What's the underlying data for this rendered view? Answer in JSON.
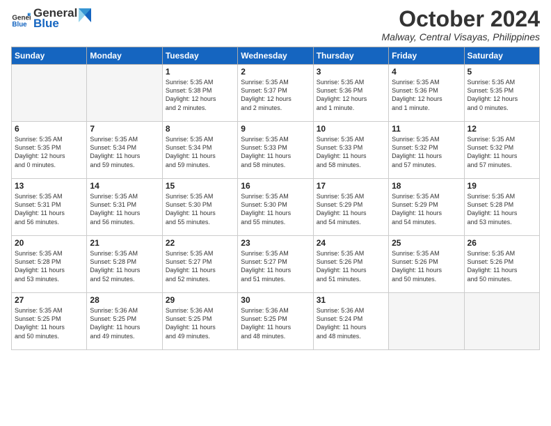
{
  "header": {
    "logo_general": "General",
    "logo_blue": "Blue",
    "month": "October 2024",
    "location": "Malway, Central Visayas, Philippines"
  },
  "days_of_week": [
    "Sunday",
    "Monday",
    "Tuesday",
    "Wednesday",
    "Thursday",
    "Friday",
    "Saturday"
  ],
  "weeks": [
    [
      {
        "day": "",
        "info": ""
      },
      {
        "day": "",
        "info": ""
      },
      {
        "day": "1",
        "info": "Sunrise: 5:35 AM\nSunset: 5:38 PM\nDaylight: 12 hours\nand 2 minutes."
      },
      {
        "day": "2",
        "info": "Sunrise: 5:35 AM\nSunset: 5:37 PM\nDaylight: 12 hours\nand 2 minutes."
      },
      {
        "day": "3",
        "info": "Sunrise: 5:35 AM\nSunset: 5:36 PM\nDaylight: 12 hours\nand 1 minute."
      },
      {
        "day": "4",
        "info": "Sunrise: 5:35 AM\nSunset: 5:36 PM\nDaylight: 12 hours\nand 1 minute."
      },
      {
        "day": "5",
        "info": "Sunrise: 5:35 AM\nSunset: 5:35 PM\nDaylight: 12 hours\nand 0 minutes."
      }
    ],
    [
      {
        "day": "6",
        "info": "Sunrise: 5:35 AM\nSunset: 5:35 PM\nDaylight: 12 hours\nand 0 minutes."
      },
      {
        "day": "7",
        "info": "Sunrise: 5:35 AM\nSunset: 5:34 PM\nDaylight: 11 hours\nand 59 minutes."
      },
      {
        "day": "8",
        "info": "Sunrise: 5:35 AM\nSunset: 5:34 PM\nDaylight: 11 hours\nand 59 minutes."
      },
      {
        "day": "9",
        "info": "Sunrise: 5:35 AM\nSunset: 5:33 PM\nDaylight: 11 hours\nand 58 minutes."
      },
      {
        "day": "10",
        "info": "Sunrise: 5:35 AM\nSunset: 5:33 PM\nDaylight: 11 hours\nand 58 minutes."
      },
      {
        "day": "11",
        "info": "Sunrise: 5:35 AM\nSunset: 5:32 PM\nDaylight: 11 hours\nand 57 minutes."
      },
      {
        "day": "12",
        "info": "Sunrise: 5:35 AM\nSunset: 5:32 PM\nDaylight: 11 hours\nand 57 minutes."
      }
    ],
    [
      {
        "day": "13",
        "info": "Sunrise: 5:35 AM\nSunset: 5:31 PM\nDaylight: 11 hours\nand 56 minutes."
      },
      {
        "day": "14",
        "info": "Sunrise: 5:35 AM\nSunset: 5:31 PM\nDaylight: 11 hours\nand 56 minutes."
      },
      {
        "day": "15",
        "info": "Sunrise: 5:35 AM\nSunset: 5:30 PM\nDaylight: 11 hours\nand 55 minutes."
      },
      {
        "day": "16",
        "info": "Sunrise: 5:35 AM\nSunset: 5:30 PM\nDaylight: 11 hours\nand 55 minutes."
      },
      {
        "day": "17",
        "info": "Sunrise: 5:35 AM\nSunset: 5:29 PM\nDaylight: 11 hours\nand 54 minutes."
      },
      {
        "day": "18",
        "info": "Sunrise: 5:35 AM\nSunset: 5:29 PM\nDaylight: 11 hours\nand 54 minutes."
      },
      {
        "day": "19",
        "info": "Sunrise: 5:35 AM\nSunset: 5:28 PM\nDaylight: 11 hours\nand 53 minutes."
      }
    ],
    [
      {
        "day": "20",
        "info": "Sunrise: 5:35 AM\nSunset: 5:28 PM\nDaylight: 11 hours\nand 53 minutes."
      },
      {
        "day": "21",
        "info": "Sunrise: 5:35 AM\nSunset: 5:28 PM\nDaylight: 11 hours\nand 52 minutes."
      },
      {
        "day": "22",
        "info": "Sunrise: 5:35 AM\nSunset: 5:27 PM\nDaylight: 11 hours\nand 52 minutes."
      },
      {
        "day": "23",
        "info": "Sunrise: 5:35 AM\nSunset: 5:27 PM\nDaylight: 11 hours\nand 51 minutes."
      },
      {
        "day": "24",
        "info": "Sunrise: 5:35 AM\nSunset: 5:26 PM\nDaylight: 11 hours\nand 51 minutes."
      },
      {
        "day": "25",
        "info": "Sunrise: 5:35 AM\nSunset: 5:26 PM\nDaylight: 11 hours\nand 50 minutes."
      },
      {
        "day": "26",
        "info": "Sunrise: 5:35 AM\nSunset: 5:26 PM\nDaylight: 11 hours\nand 50 minutes."
      }
    ],
    [
      {
        "day": "27",
        "info": "Sunrise: 5:35 AM\nSunset: 5:25 PM\nDaylight: 11 hours\nand 50 minutes."
      },
      {
        "day": "28",
        "info": "Sunrise: 5:36 AM\nSunset: 5:25 PM\nDaylight: 11 hours\nand 49 minutes."
      },
      {
        "day": "29",
        "info": "Sunrise: 5:36 AM\nSunset: 5:25 PM\nDaylight: 11 hours\nand 49 minutes."
      },
      {
        "day": "30",
        "info": "Sunrise: 5:36 AM\nSunset: 5:25 PM\nDaylight: 11 hours\nand 48 minutes."
      },
      {
        "day": "31",
        "info": "Sunrise: 5:36 AM\nSunset: 5:24 PM\nDaylight: 11 hours\nand 48 minutes."
      },
      {
        "day": "",
        "info": ""
      },
      {
        "day": "",
        "info": ""
      }
    ]
  ]
}
